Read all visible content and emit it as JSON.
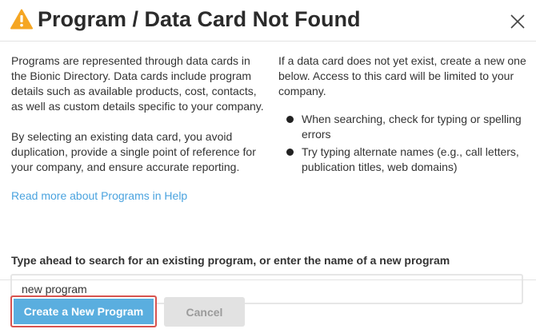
{
  "dialog": {
    "title": "Program / Data Card Not Found",
    "warning_color": "#f5a623",
    "accent_color": "#5aaedf",
    "link_color": "#4aa3df",
    "highlight_color": "#d9534f"
  },
  "left_column": {
    "paragraph1": "Programs are represented through data cards in the Bionic Directory. Data cards include program details such as available products, cost, contacts, as well as custom details specific to your company.",
    "paragraph2": "By selecting an existing data card, you avoid duplication, provide a single point of reference for your company, and ensure accurate reporting.",
    "help_link": "Read more about Programs in Help"
  },
  "right_column": {
    "paragraph": "If a data card does not yet exist, create a new one below. Access to this card will be limited to your company.",
    "bullets": [
      "When searching, check for typing or spelling errors",
      "Try typing alternate names (e.g., call letters, publication titles, web domains)"
    ]
  },
  "search": {
    "label": "Type ahead to search for an existing program, or enter the name of a new program",
    "value": "new program"
  },
  "footer": {
    "create_label": "Create a New Program",
    "cancel_label": "Cancel"
  },
  "icons": {
    "warning": "warning-triangle-icon",
    "close": "close-icon"
  }
}
